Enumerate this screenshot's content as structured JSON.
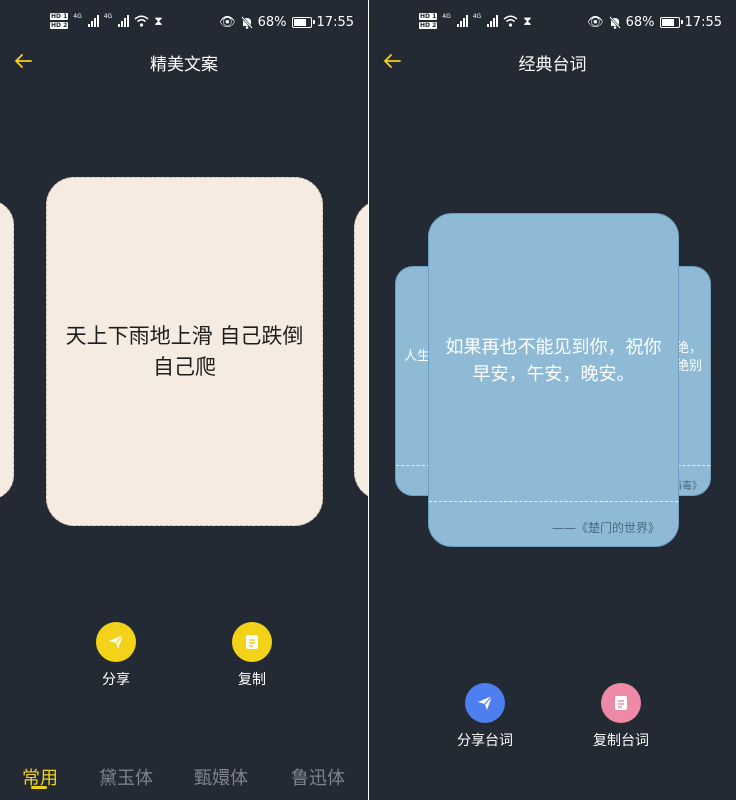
{
  "status": {
    "battery": "68%",
    "battery_level": 0.68,
    "time": "17:55",
    "hd1": "HD 1",
    "hd2": "HD 2",
    "net1": "4G",
    "net2": "4G"
  },
  "left_screen": {
    "title": "精美文案",
    "back_icon": "arrow-left-icon",
    "card_text": "天上下雨地上滑 自己跌倒自己爬",
    "actions": {
      "share_label": "分享",
      "copy_label": "复制"
    },
    "font_tabs": [
      {
        "label": "常用"
      },
      {
        "label": "黛玉体"
      },
      {
        "label": "甄嬛体"
      },
      {
        "label": "鲁迅体"
      }
    ],
    "active_tab": "常用",
    "colors": {
      "accent": "#f3d21a",
      "card": "#f5ebe0",
      "background": "#242a33"
    }
  },
  "right_screen": {
    "title": "经典台词",
    "back_icon": "arrow-left-icon",
    "quote": "如果再也不能见到你，祝你早安，午安，晚安。",
    "source": "——《楚门的世界》",
    "peek_left": "人生",
    "peek_right_1": "绝，",
    "peek_right_2": "绝别",
    "peek_right_source": "西毒》",
    "actions": {
      "share_label": "分享台词",
      "copy_label": "复制台词"
    },
    "colors": {
      "card": "#8ebad6",
      "share": "#4f7ef0",
      "copy": "#ee8aa8"
    }
  }
}
